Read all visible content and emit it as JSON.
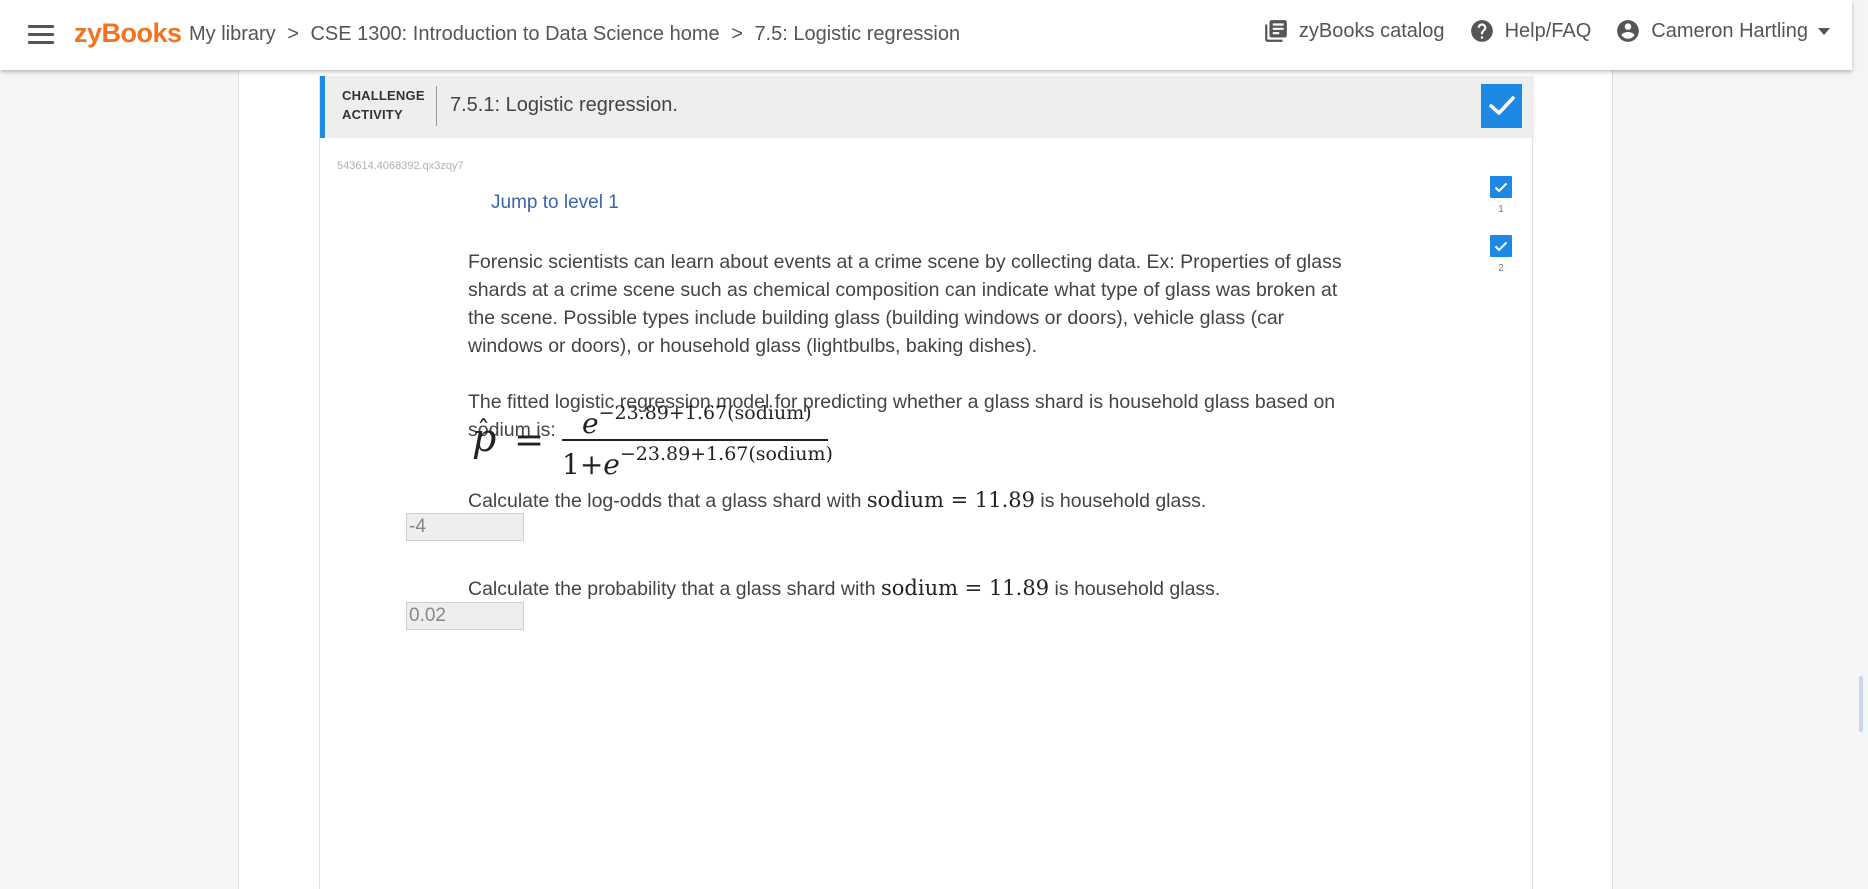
{
  "topbar": {
    "logo": "zyBooks",
    "breadcrumb": {
      "library": "My library",
      "sep": ">",
      "course": "CSE 1300: Introduction to Data Science home",
      "section": "7.5: Logistic regression"
    },
    "catalog_label": "zyBooks catalog",
    "help_label": "Help/FAQ",
    "user_name": "Cameron Hartling"
  },
  "activity": {
    "type_line1": "CHALLENGE",
    "type_line2": "ACTIVITY",
    "title": "7.5.1: Logistic regression.",
    "id": "543614.4068392.qx3zqy7",
    "jump_label": "Jump to level 1",
    "levels": [
      {
        "num": "1",
        "completed": true
      },
      {
        "num": "2",
        "completed": true
      }
    ],
    "paragraph1": "Forensic scientists can learn about events at a crime scene by collecting data. Ex: Properties of glass shards at a crime scene such as chemical composition can indicate what type of glass was broken at the scene. Possible types include building glass (building windows or doors), vehicle glass (car windows or doors), or household glass (lightbulbs, baking dishes).",
    "paragraph2": "The fitted logistic regression model for predicting whether a glass shard is household glass based on sodium is:",
    "formula": {
      "lhs": "p",
      "equals": "=",
      "numerator_base": "e",
      "exponent": "−23.89+1.67(sodium)",
      "denominator_prefix": "1+",
      "denominator_base": "e"
    },
    "question1": {
      "before": "Calculate the log-odds that a glass shard with ",
      "math": "sodium = 11.89",
      "after": " is household glass.",
      "answer": "-4"
    },
    "question2": {
      "before": "Calculate the probability that a glass shard with ",
      "math": "sodium = 11.89",
      "after": " is household glass.",
      "answer": "0.02"
    }
  },
  "colors": {
    "brand": "#f37321",
    "accent": "#1e88e5",
    "link": "#3a66a8"
  }
}
